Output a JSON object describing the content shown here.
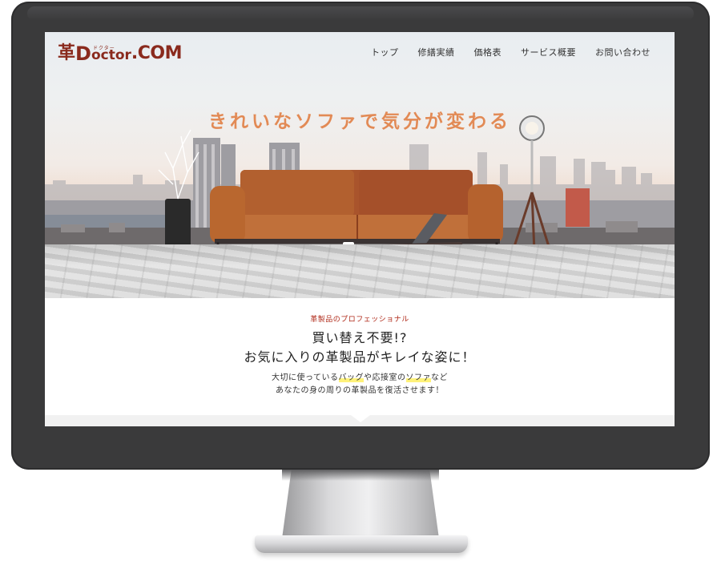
{
  "logo": {
    "kanji": "革",
    "d": "D",
    "rest": "octor",
    "ruby": "ドクター",
    "com": ".COM"
  },
  "nav": {
    "items": [
      {
        "label": "トップ"
      },
      {
        "label": "修繕実績"
      },
      {
        "label": "価格表"
      },
      {
        "label": "サービス概要"
      },
      {
        "label": "お問い合わせ"
      }
    ]
  },
  "hero": {
    "title": "きれいなソファで気分が変わる"
  },
  "intro": {
    "tag": "革製品のプロフェッショナル",
    "heading_line1": "買い替え不要!?",
    "heading_line2": "お気に入りの革製品がキレイな姿に！",
    "body_line1_a": "大切に使っている",
    "body_line1_hl1": "バッグ",
    "body_line1_b": "や応接室の",
    "body_line1_hl2": "ソファ",
    "body_line1_c": "など",
    "body_line2": "あなたの身の周りの革製品を復活させます！"
  },
  "colors": {
    "brand": "#8a2a1d",
    "hero_title": "#e28a55",
    "tag": "#b02a1a",
    "highlight": "#fff27a",
    "sofa": "#a9542c",
    "bezel": "#3a3a3b"
  }
}
